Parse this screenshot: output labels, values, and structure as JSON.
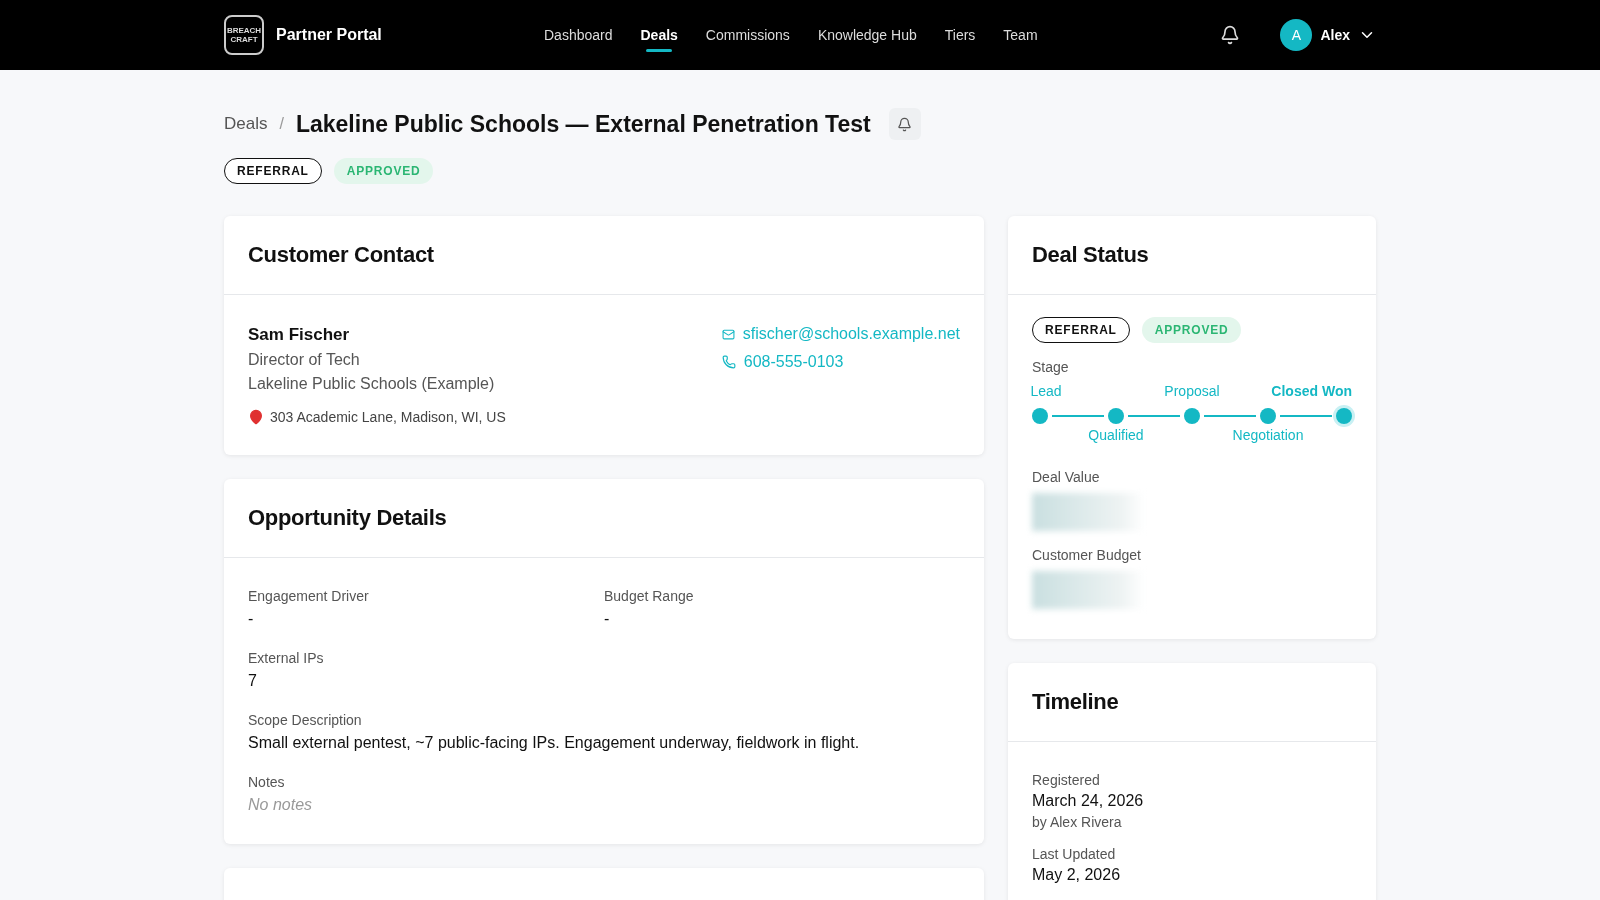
{
  "header": {
    "logo_top": "BREACH",
    "logo_bottom": "CRAFT",
    "title": "Partner Portal",
    "nav": [
      {
        "label": "Dashboard",
        "selected": false
      },
      {
        "label": "Deals",
        "selected": true
      },
      {
        "label": "Commissions",
        "selected": false
      },
      {
        "label": "Knowledge Hub",
        "selected": false
      },
      {
        "label": "Tiers",
        "selected": false
      },
      {
        "label": "Team",
        "selected": false
      }
    ],
    "user": {
      "initial": "A",
      "name": "Alex"
    }
  },
  "breadcrumb": {
    "parent": "Deals",
    "separator": "/",
    "title": "Lakeline Public Schools — External Penetration Test"
  },
  "badges": [
    {
      "label": "REFERRAL",
      "kind": "outline"
    },
    {
      "label": "APPROVED",
      "kind": "success"
    }
  ],
  "customer_contact": {
    "title": "Customer Contact",
    "name": "Sam Fischer",
    "role": "Director of Tech",
    "company": "Lakeline Public Schools (Example)",
    "address": "303 Academic Lane, Madison, WI, US",
    "email": "sfischer@schools.example.net",
    "phone": "608-555-0103"
  },
  "opportunity": {
    "title": "Opportunity Details",
    "fields": [
      {
        "label": "Engagement Driver",
        "value": "-"
      },
      {
        "label": "Budget Range",
        "value": "-"
      },
      {
        "label": "External IPs",
        "value": "7"
      },
      {
        "label": "Scope Description",
        "value": "Small external pentest, ~7 public-facing IPs. Engagement underway, fieldwork in flight."
      }
    ],
    "notes_label": "Notes",
    "notes_placeholder": "No notes"
  },
  "deal_status": {
    "title": "Deal Status",
    "badges": [
      {
        "label": "REFERRAL",
        "kind": "outline"
      },
      {
        "label": "APPROVED",
        "kind": "success"
      }
    ],
    "stage_label": "Stage",
    "stages": [
      {
        "label": "Lead",
        "selected": false
      },
      {
        "label": "Qualified",
        "selected": false
      },
      {
        "label": "Proposal",
        "selected": false
      },
      {
        "label": "Negotiation",
        "selected": false
      },
      {
        "label": "Closed Won",
        "selected": true
      }
    ],
    "deal_value_label": "Deal Value",
    "customer_budget_label": "Customer Budget"
  },
  "timeline": {
    "title": "Timeline",
    "entries": [
      {
        "label": "Registered",
        "value": "March 24, 2026",
        "by": "by Alex Rivera"
      },
      {
        "label": "Last Updated",
        "value": "May 2, 2026"
      }
    ]
  }
}
